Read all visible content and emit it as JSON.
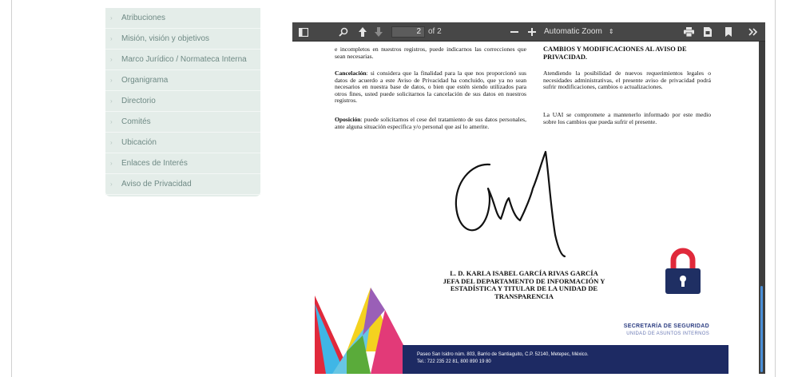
{
  "sidebar": {
    "items": [
      {
        "label": "Atribuciones"
      },
      {
        "label": "Misión, visión y objetivos"
      },
      {
        "label": "Marco Jurídico / Normateca Interna"
      },
      {
        "label": "Organigrama"
      },
      {
        "label": "Directorio"
      },
      {
        "label": "Comités"
      },
      {
        "label": "Ubicación"
      },
      {
        "label": "Enlaces de Interés"
      },
      {
        "label": "Aviso de Privacidad"
      }
    ]
  },
  "viewer": {
    "page_value": "2",
    "page_count": "of 2",
    "zoom_label": "Automatic Zoom",
    "icons": [
      "sidebar-toggle-icon",
      "search-icon",
      "arrow-up-icon",
      "arrow-down-icon",
      "minus-icon",
      "plus-icon",
      "print-icon",
      "download-icon",
      "bookmark-icon",
      "double-chevron-right-icon"
    ]
  },
  "document": {
    "left_col": {
      "p1": "e incompletos en nuestros registros, puede indicarnos las correcciones que sean necesarias.",
      "p2_label": "Cancelación",
      "p2": ": si considera que la finalidad para la que nos proporcionó sus datos de acuerdo a este Aviso de Privacidad ha concluido, que ya no sean necesarios en nuestra base de datos, o bien que estén siendo utilizados para otros fines, usted puede solicitarnos la cancelación de sus datos en nuestros registros.",
      "p3_label": "Oposición",
      "p3": ": puede solicitarnos el cese del tratamiento de sus datos personales, ante alguna situación específica y/o personal que así lo amerite."
    },
    "right_col": {
      "heading": "CAMBIOS Y MODIFICACIONES AL AVISO DE PRIVACIDAD.",
      "p1": "Atendiendo la posibilidad de nuevos requerimientos legales o necesidades administrativas, el presente aviso de privacidad podrá sufrir modificaciones, cambios o actualizaciones.",
      "p2": "La UAI se compromete a mantenerlo informado por este medio sobre los cambios que pueda sufrir el presente."
    },
    "signatory": {
      "line1": "L. D. KARLA ISABEL GARCÍA RIVAS GARCÍA",
      "line2": "JEFA DEL DEPARTAMENTO DE INFORMACIÓN Y",
      "line3": "ESTADÍSTICA Y TITULAR DE LA UNIDAD DE",
      "line4": "TRANSPARENCIA"
    },
    "agency": {
      "title": "SECRETARÍA DE SEGURIDAD",
      "subtitle": "UNIDAD DE ASUNTOS INTERNOS"
    },
    "footer": {
      "address": "Paseo San Isidro núm. 803, Barrio de Santiaguito, C.P. 52140, Metepec, México.",
      "phone": "Tel.: 722 235 22 81, 800 890 19 80"
    }
  },
  "colors": {
    "sidebar_bg": "#e4ede9",
    "sidebar_text": "#6f8a85",
    "viewer_toolbar": "#474747",
    "lock_red": "#e0293b",
    "lock_body": "#1f2f63",
    "footer_bar": "#1d2a63",
    "scroll_accent": "#4a90d9"
  }
}
